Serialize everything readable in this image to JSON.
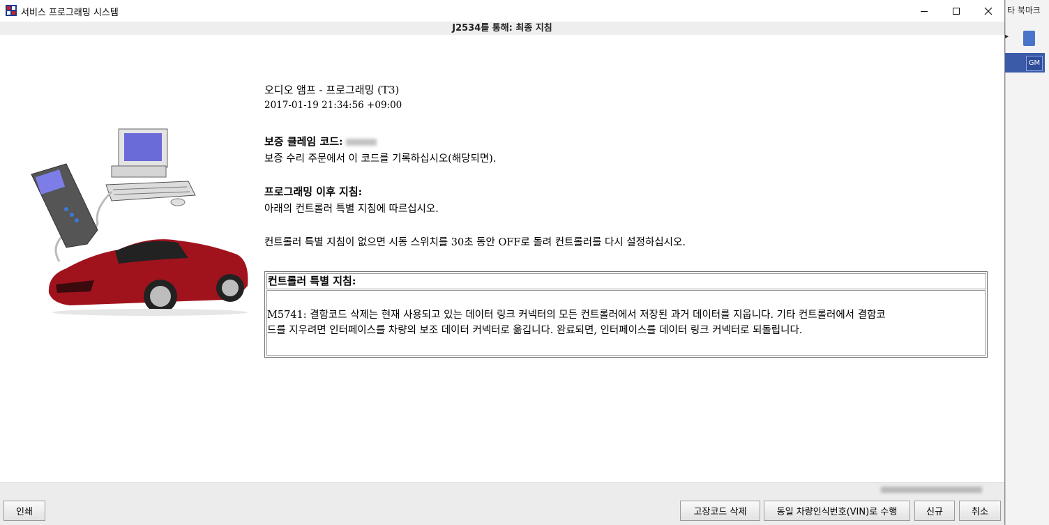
{
  "window": {
    "title": "서비스 프로그래밍 시스템",
    "subheader": "J2534를 통해: 최종 지침"
  },
  "background": {
    "bookmark_label": "타 북마크",
    "gm_logo": "GM"
  },
  "content": {
    "module_title": "오디오 앰프 - 프로그래밍 (T3)",
    "timestamp": "2017-01-19 21:34:56 +09:00",
    "warranty_heading": "보증 클레임 코드:",
    "warranty_note": "보증 수리 주문에서 이 코드를 기록하십시오(해당되면).",
    "post_heading": "프로그래밍 이후 지침:",
    "post_note": "아래의 컨트롤러 특별 지침에 따르십시오.",
    "reset_note": "컨트롤러 특별 지침이 없으면 시동 스위치를 30초 동안 OFF로 돌려 컨트롤러를 다시 설정하십시오."
  },
  "special_box": {
    "heading": "컨트롤러 특별 지침:",
    "line1": "M5741: 결함코드 삭제는 현재 사용되고 있는 데이터 링크 커넥터의 모든 컨트롤러에서 저장된 과거 데이터를 지웁니다. 기타 컨트롤러에서 결함코",
    "line2": "드를 지우려면 인터페이스를 차량의 보조 데이터 커넥터로 옮깁니다. 완료되면, 인터페이스를 데이터 링크 커넥터로 되돌립니다."
  },
  "buttons": {
    "print": "인쇄",
    "clear_dtc": "고장코드 삭제",
    "same_vin": "동일 차량인식번호(VIN)로 수행",
    "new": "신규",
    "cancel": "취소"
  },
  "icons": {
    "app": "sps-app-icon",
    "minimize": "minimize-icon",
    "maximize": "maximize-icon",
    "close": "close-icon"
  }
}
